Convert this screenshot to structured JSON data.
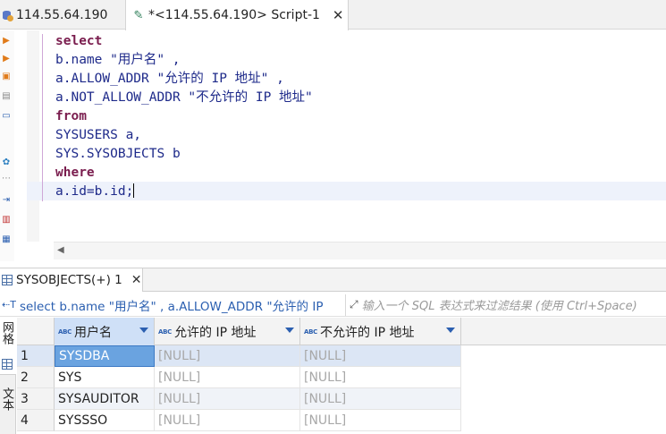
{
  "tabs": [
    {
      "label": "114.55.64.190"
    },
    {
      "label": "*<114.55.64.190> Script-1"
    }
  ],
  "editor": {
    "lines": [
      {
        "parts": [
          {
            "t": "kw",
            "v": "select"
          }
        ]
      },
      {
        "parts": [
          {
            "t": "id",
            "v": "b.name "
          },
          {
            "t": "str",
            "v": "\"用户名\""
          },
          {
            "t": "id",
            "v": " ,"
          }
        ]
      },
      {
        "parts": [
          {
            "t": "id",
            "v": "a.ALLOW_ADDR "
          },
          {
            "t": "str",
            "v": "\"允许的 IP 地址\""
          },
          {
            "t": "id",
            "v": " ,"
          }
        ]
      },
      {
        "parts": [
          {
            "t": "id",
            "v": "a.NOT_ALLOW_ADDR "
          },
          {
            "t": "str",
            "v": "\"不允许的 IP 地址\""
          }
        ]
      },
      {
        "parts": [
          {
            "t": "kw",
            "v": "from"
          }
        ]
      },
      {
        "parts": [
          {
            "t": "id",
            "v": "SYSUSERS a,"
          }
        ]
      },
      {
        "parts": [
          {
            "t": "id",
            "v": "SYS.SYSOBJECTS b"
          }
        ]
      },
      {
        "parts": [
          {
            "t": "kw",
            "v": "where"
          }
        ]
      },
      {
        "parts": [
          {
            "t": "id",
            "v": "a.id=b.id;"
          }
        ]
      }
    ]
  },
  "results": {
    "tab_label": "SYSOBJECTS(+) 1",
    "filter_sql": "select b.name \"用户名\" , a.ALLOW_ADDR \"允许的 IP",
    "filter_placeholder": "输入一个 SQL 表达式来过滤结果 (使用 Ctrl+Space)",
    "side_tabs": [
      "网格",
      "文本"
    ],
    "columns": [
      "用户名",
      "允许的 IP 地址",
      "不允许的 IP 地址"
    ],
    "rows": [
      {
        "n": "1",
        "c1": "SYSDBA",
        "c2": "[NULL]",
        "c3": "[NULL]"
      },
      {
        "n": "2",
        "c1": "SYS",
        "c2": "[NULL]",
        "c3": "[NULL]"
      },
      {
        "n": "3",
        "c1": "SYSAUDITOR",
        "c2": "[NULL]",
        "c3": "[NULL]"
      },
      {
        "n": "4",
        "c1": "SYSSSO",
        "c2": "[NULL]",
        "c3": "[NULL]"
      }
    ]
  },
  "colors": {
    "keyword": "#7a1d4e",
    "identifier": "#1e2a8a",
    "selection": "#6aa3e0",
    "null": "#a8a8a8"
  }
}
